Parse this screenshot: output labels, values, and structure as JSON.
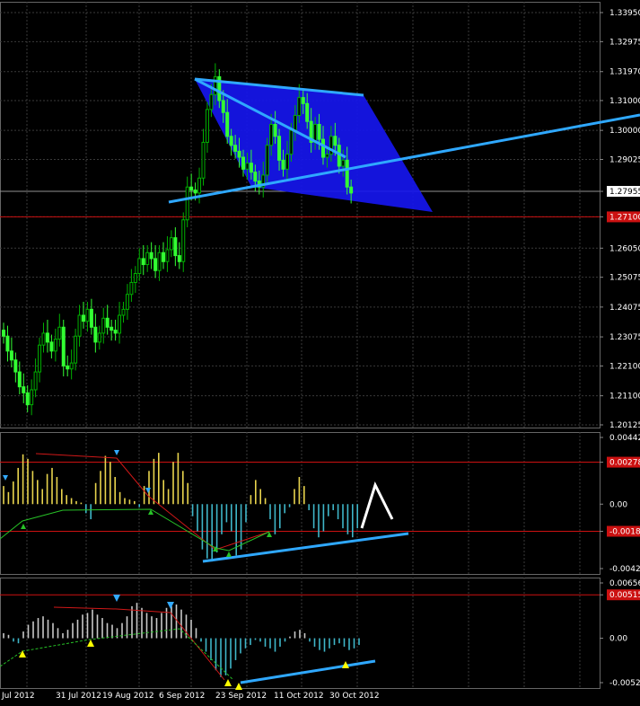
{
  "colors": {
    "background": "#000000",
    "grid": "#3a3a3a",
    "axis_text": "#ffffff",
    "candle_up": "#00b000",
    "candle_down": "#33ff33",
    "channel_fill": "#1616ee",
    "trendline": "#2fa8ff",
    "horizontal_red": "#cc1111",
    "current_price_line": "#909090",
    "histogram_positive": "#e8d44d",
    "histogram_negative": "#3fb6c8",
    "signal_red": "#d01818",
    "signal_green": "#27c127",
    "arrow_up": "#ffff00",
    "arrow_down": "#33aaff",
    "pattern_white": "#ffffff"
  },
  "chart_data": [
    {
      "type": "line",
      "name": "EURUSD daily candles",
      "x_labels": [
        "Jul 2012",
        "31 Jul 2012",
        "19 Aug 2012",
        "6 Sep 2012",
        "23 Sep 2012",
        "11 Oct 2012",
        "30 Oct 2012"
      ],
      "y_ticks": [
        "1.33950",
        "1.32975",
        "1.31970",
        "1.31000",
        "1.30000",
        "1.29025",
        "1.27955",
        "1.27100",
        "1.26050",
        "1.25075",
        "1.24075",
        "1.23075",
        "1.22100",
        "1.21100",
        "1.20125"
      ],
      "ylim": [
        1.20125,
        1.3395
      ],
      "current_price": "1.27955",
      "red_level": "1.27100",
      "closes": [
        1.231,
        1.226,
        1.223,
        1.219,
        1.214,
        1.212,
        1.208,
        1.213,
        1.219,
        1.228,
        1.232,
        1.229,
        1.226,
        1.23,
        1.234,
        1.221,
        1.22,
        1.222,
        1.231,
        1.238,
        1.236,
        1.24,
        1.234,
        1.229,
        1.232,
        1.237,
        1.234,
        1.233,
        1.232,
        1.238,
        1.24,
        1.245,
        1.249,
        1.252,
        1.257,
        1.255,
        1.259,
        1.257,
        1.253,
        1.259,
        1.256,
        1.26,
        1.264,
        1.258,
        1.256,
        1.27,
        1.281,
        1.28,
        1.279,
        1.284,
        1.296,
        1.307,
        1.312,
        1.318,
        1.31,
        1.306,
        1.298,
        1.295,
        1.293,
        1.291,
        1.287,
        1.289,
        1.286,
        1.283,
        1.281,
        1.285,
        1.295,
        1.302,
        1.298,
        1.29,
        1.287,
        1.292,
        1.3,
        1.305,
        1.311,
        1.309,
        1.303,
        1.296,
        1.302,
        1.297,
        1.291,
        1.292,
        1.298,
        1.295,
        1.288,
        1.29,
        1.281,
        1.279
      ]
    },
    {
      "type": "bar",
      "name": "Oscillator 1",
      "y_ticks": [
        "0.00442",
        "0.00278",
        "0.00",
        "-0.0018",
        "-0.00427"
      ],
      "ylim": [
        -0.00427,
        0.00442
      ],
      "upper_level": "0.00278",
      "lower_level": "-0.0018",
      "values": [
        0.0012,
        0.0008,
        0.0015,
        0.0024,
        0.0033,
        0.003,
        0.0022,
        0.0016,
        0.001,
        0.002,
        0.0024,
        0.0018,
        0.001,
        0.0006,
        0.0004,
        0.0002,
        0.0001,
        -0.0006,
        -0.001,
        0.0014,
        0.0022,
        0.0032,
        0.0028,
        0.0018,
        0.0008,
        0.0004,
        0.0003,
        0.0002,
        -0.0002,
        0.0012,
        0.0022,
        0.003,
        0.0034,
        0.0016,
        0.001,
        0.0028,
        0.0034,
        0.0022,
        0.0014,
        -0.0008,
        -0.0018,
        -0.003,
        -0.0036,
        -0.0038,
        -0.0032,
        -0.002,
        -0.0012,
        -0.0018,
        -0.0034,
        -0.003,
        -0.0012,
        0.0006,
        0.0016,
        0.001,
        0.0004,
        -0.001,
        -0.002,
        -0.0016,
        -0.0006,
        -0.0002,
        0.001,
        0.0018,
        0.0012,
        -0.0004,
        -0.0016,
        -0.0022,
        -0.0018,
        -0.0008,
        -0.0004,
        -0.001,
        -0.0016,
        -0.002,
        -0.0022,
        -0.0016
      ]
    },
    {
      "type": "bar",
      "name": "Oscillator 2",
      "y_ticks": [
        "0.00656",
        "0.00515",
        "0.00",
        "-0.00527"
      ],
      "ylim": [
        -0.00527,
        0.00656
      ],
      "upper_level": "0.00515",
      "values": [
        0.0006,
        0.0004,
        -0.0004,
        -0.0006,
        0.0008,
        0.0016,
        0.002,
        0.0024,
        0.0026,
        0.0022,
        0.0018,
        0.0012,
        0.0006,
        0.001,
        0.0018,
        0.0022,
        0.0028,
        0.003,
        0.0034,
        0.0028,
        0.0024,
        0.0018,
        0.0016,
        0.0012,
        0.0018,
        0.0026,
        0.0038,
        0.0042,
        0.0036,
        0.003,
        0.0026,
        0.0024,
        0.003,
        0.0036,
        0.0038,
        0.004,
        0.0034,
        0.0028,
        0.0022,
        0.0012,
        -0.0004,
        -0.0016,
        -0.0026,
        -0.0038,
        -0.0046,
        -0.0044,
        -0.0036,
        -0.0026,
        -0.0018,
        -0.0012,
        -0.0008,
        -0.0002,
        -0.0004,
        -0.001,
        -0.0012,
        -0.0016,
        -0.001,
        -0.0004,
        0.0002,
        0.0008,
        0.001,
        0.0006,
        -0.0004,
        -0.001,
        -0.0014,
        -0.0016,
        -0.0012,
        -0.0008,
        -0.0006,
        -0.001,
        -0.0014,
        -0.0012,
        -0.0008
      ]
    }
  ]
}
